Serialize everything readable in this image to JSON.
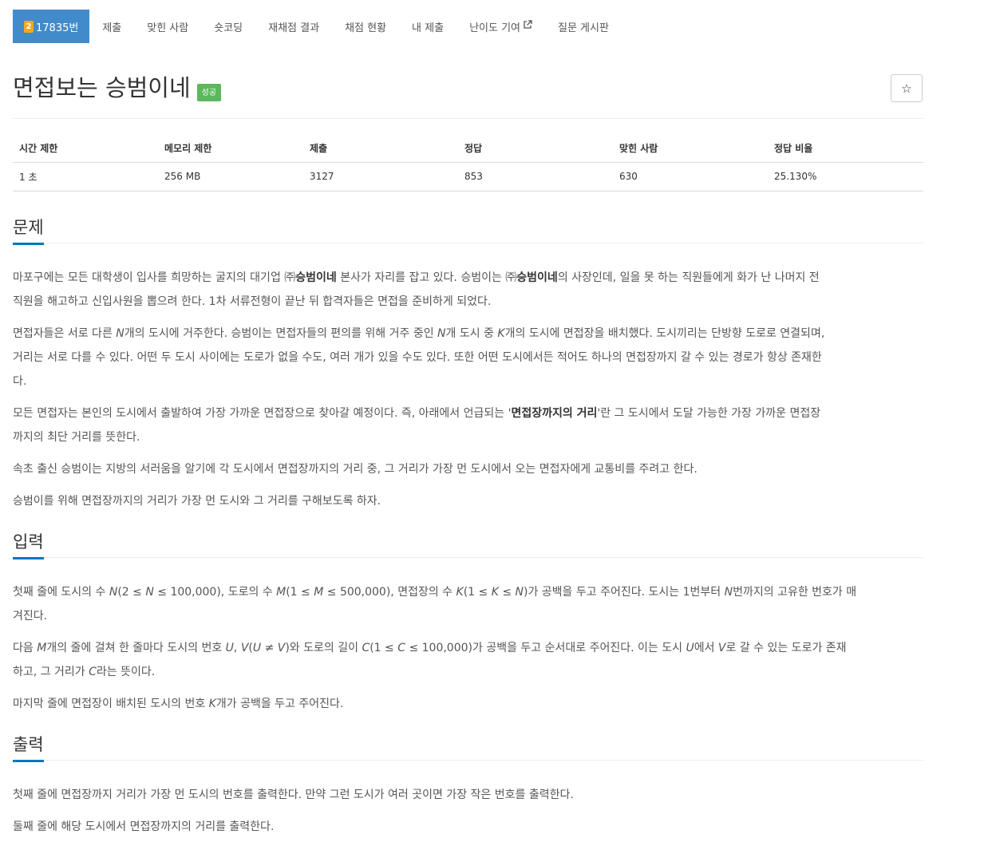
{
  "tabs": {
    "problem": {
      "tier_badge": "2",
      "label": "17835번"
    },
    "submit": "제출",
    "solved_users": "맞힌 사람",
    "shortest_code": "숏코딩",
    "rejudge_result": "재채점 결과",
    "judge_status": "채점 현황",
    "my_submissions": "내 제출",
    "difficulty_contribution": "난이도 기여",
    "board": "질문 게시판"
  },
  "problem": {
    "title": "면접보는 승범이네",
    "status_label": "성공",
    "star_glyph": "☆"
  },
  "info_table": {
    "headers": [
      "시간 제한",
      "메모리 제한",
      "제출",
      "정답",
      "맞힌 사람",
      "정답 비율"
    ],
    "values": [
      "1 초",
      "256 MB",
      "3127",
      "853",
      "630",
      "25.130%"
    ]
  },
  "sections": {
    "description": {
      "heading": "문제",
      "p1": {
        "a": "마포구에는 모든 대학생이 입사를 희망하는 굴지의 대기업 ㈜",
        "b": "승범이네",
        "c": " 본사가 자리를 잡고 있다. 승범이는 ㈜",
        "d": "승범이네",
        "e": "의 사장인데, 일을 못 하는 직원들에게 화가 난 나머지 전",
        "f": "직원을 해고하고 신입사원을 뽑으려 한다. 1차 서류전형이 끝난 뒤 합격자들은 면접을 준비하게 되었다."
      },
      "p2": {
        "a": "면접자들은 서로 다른 ",
        "N": "N",
        "b": "개의 도시에 거주한다. 승범이는 면접자들의 편의를 위해 거주 중인 ",
        "N2": "N",
        "c": "개 도시 중 ",
        "K": "K",
        "d": "개의 도시에 면접장을 배치했다. 도시끼리는 단방향 도로로 연결되며,",
        "e": "거리는 서로 다를 수 있다. 어떤 두 도시 사이에는 도로가 없을 수도, 여러 개가 있을 수도 있다. 또한 어떤 도시에서든 적어도 하나의 면접장까지 갈 수 있는 경로가 항상 존재한",
        "f": "다."
      },
      "p3": {
        "a": "모든 면접자는 본인의 도시에서 출발하여 가장 가까운 면접장으로 찾아갈 예정이다. 즉, 아래에서 언급되는 '",
        "b": "면접장까지의 거리",
        "c": "'란 그 도시에서 도달 가능한 가장 가까운 면접장",
        "d": "까지의 최단 거리를 뜻한다."
      },
      "p4": "속초 출신 승범이는 지방의 서러움을 알기에 각 도시에서 면접장까지의 거리 중, 그 거리가 가장 먼 도시에서 오는 면접자에게 교통비를 주려고 한다.",
      "p5": "승범이를 위해 면접장까지의 거리가 가장 먼 도시와 그 거리를 구해보도록 하자."
    },
    "input": {
      "heading": "입력",
      "p1": {
        "a": "첫째 줄에 도시의 수 ",
        "N": "N",
        "b": "(2 ≤ ",
        "N2": "N",
        "c": " ≤ 100,000), 도로의 수 ",
        "M": "M",
        "d": "(1 ≤ ",
        "M2": "M",
        "e": " ≤ 500,000), 면접장의 수 ",
        "K": "K",
        "f": "(1 ≤ ",
        "K2": "K",
        "g": " ≤ ",
        "N3": "N",
        "h": ")가 공백을 두고 주어진다. 도시는 1번부터 ",
        "N4": "N",
        "i": "번까지의 고유한 번호가 매",
        "j": "겨진다."
      },
      "p2": {
        "a": "다음 ",
        "M": "M",
        "b": "개의 줄에 걸쳐 한 줄마다 도시의 번호 ",
        "U": "U",
        "c": ", ",
        "V": "V",
        "d": "(",
        "U2": "U",
        "e": " ≠ ",
        "V2": "V",
        "f": ")와 도로의 길이 ",
        "C": "C",
        "g": "(1 ≤ ",
        "C2": "C",
        "h": " ≤ 100,000)가 공백을 두고 순서대로 주어진다. 이는 도시 ",
        "U3": "U",
        "i": "에서 ",
        "V3": "V",
        "j": "로 갈 수 있는 도로가 존재",
        "k": "하고, 그 거리가 ",
        "C3": "C",
        "l": "라는 뜻이다."
      },
      "p3": {
        "a": "마지막 줄에 면접장이 배치된 도시의 번호 ",
        "K": "K",
        "b": "개가 공백을 두고 주어진다."
      }
    },
    "output": {
      "heading": "출력",
      "p1": "첫째 줄에 면접장까지 거리가 가장 먼 도시의 번호를 출력한다. 만약 그런 도시가 여러 곳이면 가장 작은 번호를 출력한다.",
      "p2": "둘째 줄에 해당 도시에서 면접장까지의 거리를 출력한다."
    }
  },
  "colors": {
    "active_tab": "#428bca",
    "success_label": "#5cb85c",
    "heading_underline": "#0076c0",
    "tier_badge": "#f5a623"
  },
  "icons": [
    "external-link-icon",
    "star-icon"
  ]
}
